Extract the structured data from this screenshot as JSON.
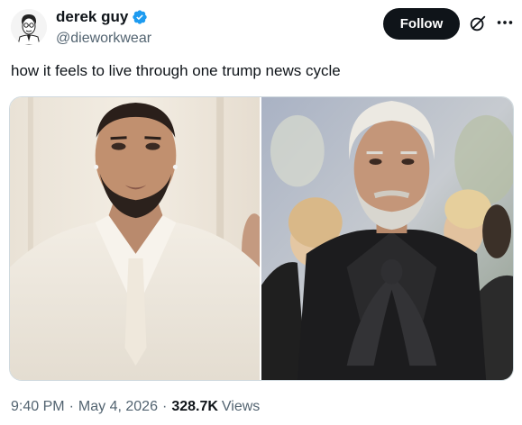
{
  "author": {
    "display_name": "derek guy",
    "handle": "@dieworkwear",
    "verified": true
  },
  "actions": {
    "follow_label": "Follow",
    "grok_icon": "grok-icon",
    "more_icon": "more-icon"
  },
  "tweet": {
    "text": "how it feels to live through one trump news cycle"
  },
  "media": {
    "images": [
      "photo-young-man-white-suit",
      "photo-older-man-black-bow"
    ]
  },
  "meta": {
    "time": "9:40 PM",
    "separator": "·",
    "date": "May 4, 2026",
    "views_count": "328.7K",
    "views_label": "Views"
  },
  "colors": {
    "text_primary": "#0f1419",
    "text_secondary": "#536471",
    "verified_blue": "#1d9bf0",
    "follow_bg": "#0f1419"
  }
}
